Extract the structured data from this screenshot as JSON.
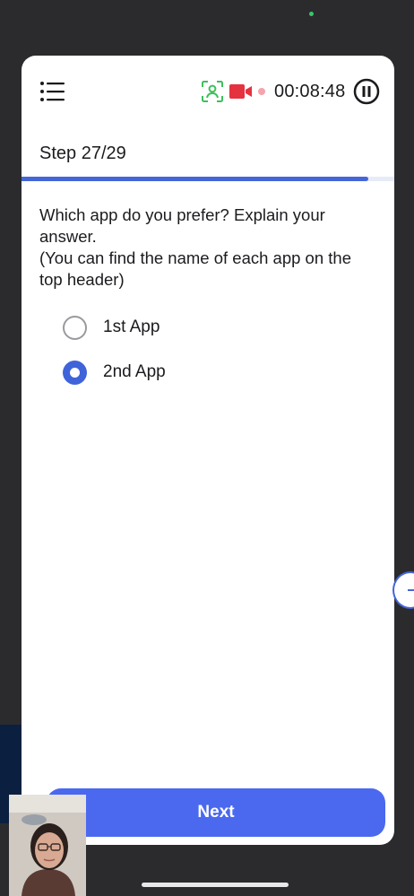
{
  "header": {
    "menu_icon": "hamburger-menu-icon",
    "face_icon": "face-detection-icon",
    "record_icon": "video-camera-icon",
    "timer": "00:08:48",
    "pause_icon": "pause-icon",
    "colors": {
      "face": "#3fbf5c",
      "record": "#e5323f",
      "record_dot": "#f5a3ad"
    }
  },
  "progress": {
    "step_label": "Step 27/29",
    "fraction": 0.931,
    "color": "#4566d9"
  },
  "question": {
    "lines": [
      "Which app do you prefer? Explain your",
      "answer.",
      "(You can find the name of each app on the",
      "top header)"
    ]
  },
  "options": [
    {
      "label": "1st App",
      "selected": false
    },
    {
      "label": "2nd App",
      "selected": true
    }
  ],
  "next_button": {
    "label": "Next",
    "color": "#4a69ef"
  },
  "webcam": {
    "icon": "webcam-preview"
  }
}
